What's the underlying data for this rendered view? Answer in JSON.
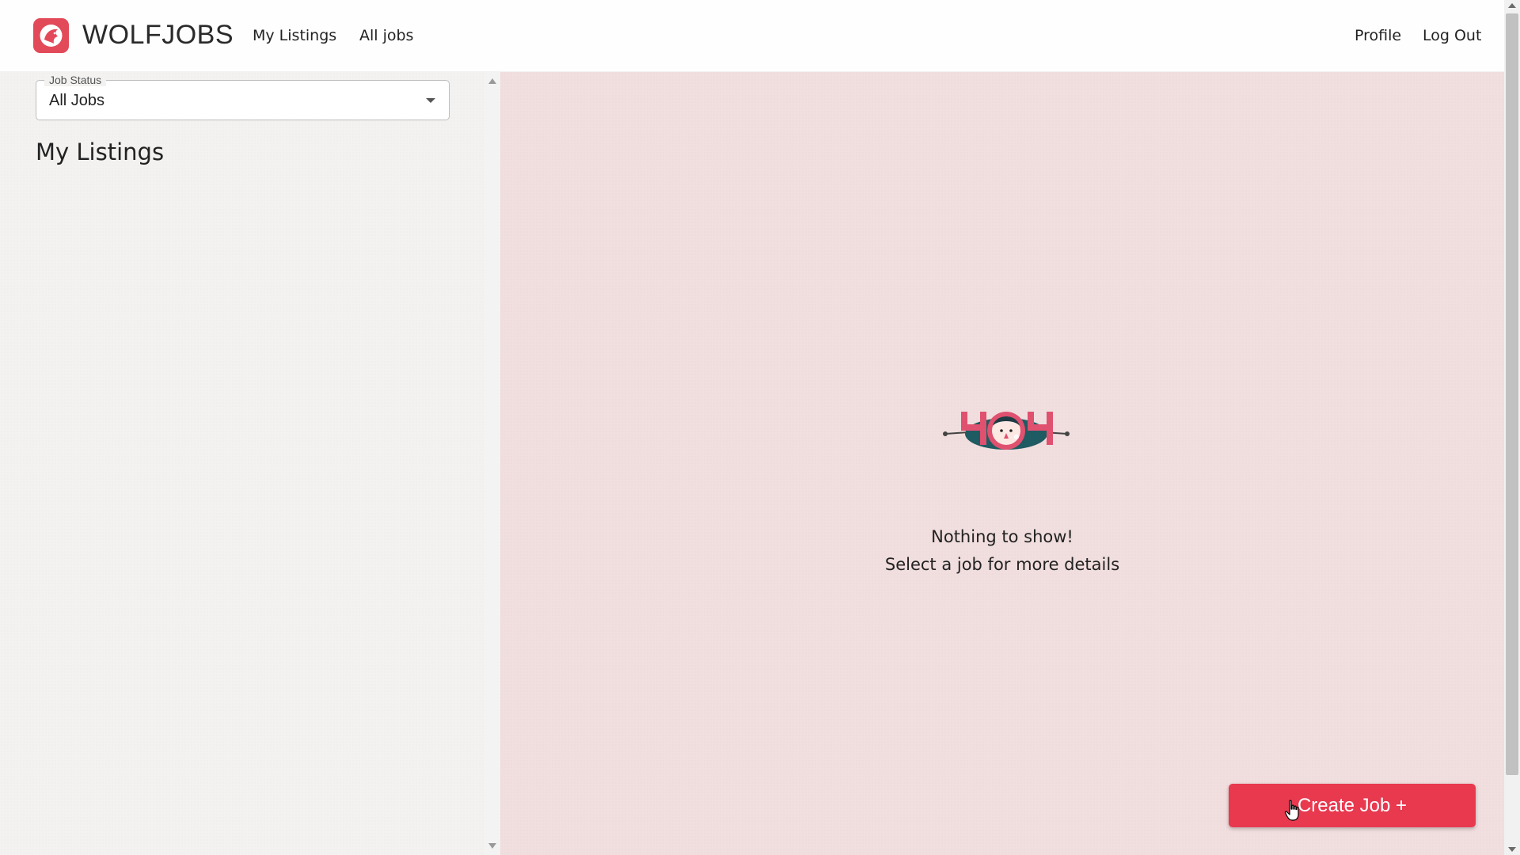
{
  "header": {
    "brand": "WOLFJOBS",
    "nav": {
      "my_listings": "My Listings",
      "all_jobs": "All jobs",
      "profile": "Profile",
      "logout": "Log Out"
    },
    "logo_icon": "wolf-logo-icon",
    "logo_color": "#e24a5a"
  },
  "sidebar": {
    "filter": {
      "label": "Job Status",
      "value": "All Jobs",
      "icon": "chevron-down-icon"
    },
    "title": "My Listings"
  },
  "main": {
    "illustration_icon": "404-illustration-icon",
    "empty_title": "Nothing to show!",
    "empty_subtitle": "Select a job for more details",
    "create_button": "Create Job +",
    "accent_color": "#e8394f"
  }
}
